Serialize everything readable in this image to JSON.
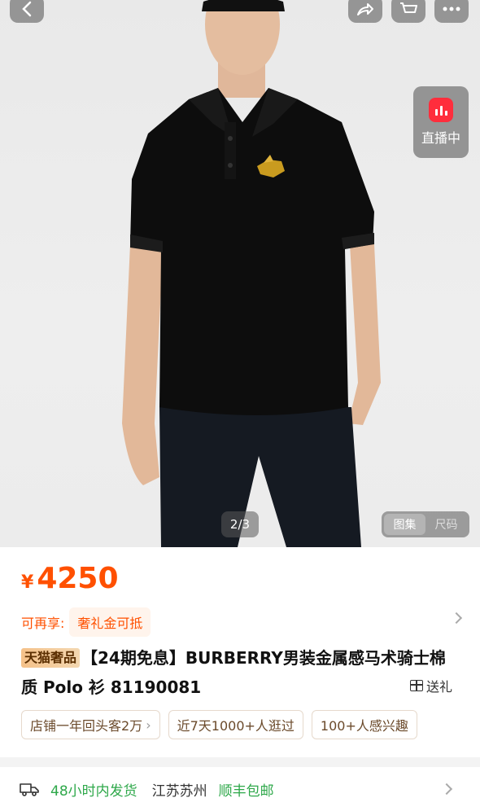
{
  "gallery": {
    "page_indicator": "2/3",
    "live_label": "直播中",
    "view_tabs": [
      "图集",
      "尺码"
    ]
  },
  "product": {
    "price_symbol": "¥",
    "price": "4250",
    "benefit_label": "可再享:",
    "benefit_tag": "奢礼金可抵",
    "badge": "天猫奢品",
    "title": "【24期免息】BURBERRY男装金属感马术骑士棉质 Polo 衫 81190081",
    "gift_label": "送礼",
    "stats": [
      "店铺一年回头客2万",
      "近7天1000+人逛过",
      "100+人感兴趣"
    ]
  },
  "shipping": {
    "fast": "48小时内发货",
    "location": "江苏苏州",
    "free": "顺丰包邮"
  },
  "colors": {
    "price": "#ff5000",
    "live_red": "#ff2d3c",
    "ship_green": "#2ea84a"
  }
}
